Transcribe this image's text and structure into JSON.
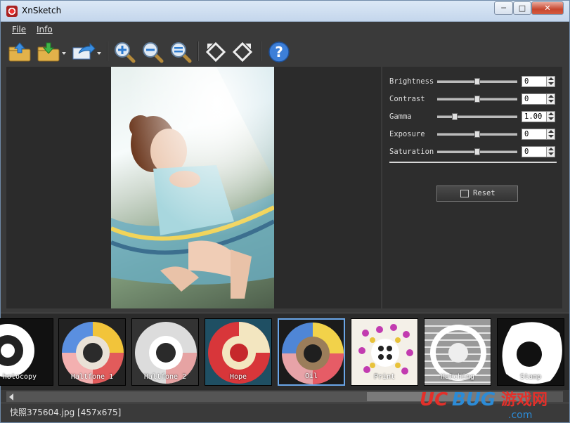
{
  "window": {
    "title": "XnSketch"
  },
  "menu": {
    "file": "File",
    "info": "Info"
  },
  "toolbar": {
    "buttons": [
      "open-icon",
      "save-icon",
      "share-icon",
      "zoom-in-icon",
      "zoom-out-icon",
      "zoom-fit-icon",
      "rotate-left-icon",
      "rotate-right-icon",
      "help-icon"
    ]
  },
  "adjustments": [
    {
      "label": "Brightness",
      "value": "0",
      "level": 0.5
    },
    {
      "label": "Contrast",
      "value": "0",
      "level": 0.5
    },
    {
      "label": "Gamma",
      "value": "1.00",
      "level": 0.2
    },
    {
      "label": "Exposure",
      "value": "0",
      "level": 0.5
    },
    {
      "label": "Saturation",
      "value": "0",
      "level": 0.5
    }
  ],
  "reset_label": "Reset",
  "filters": [
    {
      "label": "hotocopy"
    },
    {
      "label": "Haltfone 1"
    },
    {
      "label": "Haltfone 2"
    },
    {
      "label": "Hope"
    },
    {
      "label": "Oil"
    },
    {
      "label": "Print"
    },
    {
      "label": "Hatching"
    },
    {
      "label": "Stamp"
    }
  ],
  "selected_filter": "Oil",
  "status": {
    "file": "快照375604.jpg [457x675]"
  },
  "watermark": {
    "brand": "UCBUG",
    "cn": "游戏网",
    "domain": ".com"
  },
  "colors": {
    "accent": "#6aa6e8",
    "bg": "#3a3a3a",
    "brand_red": "#e3302a",
    "brand_blue": "#2c8bd6"
  }
}
